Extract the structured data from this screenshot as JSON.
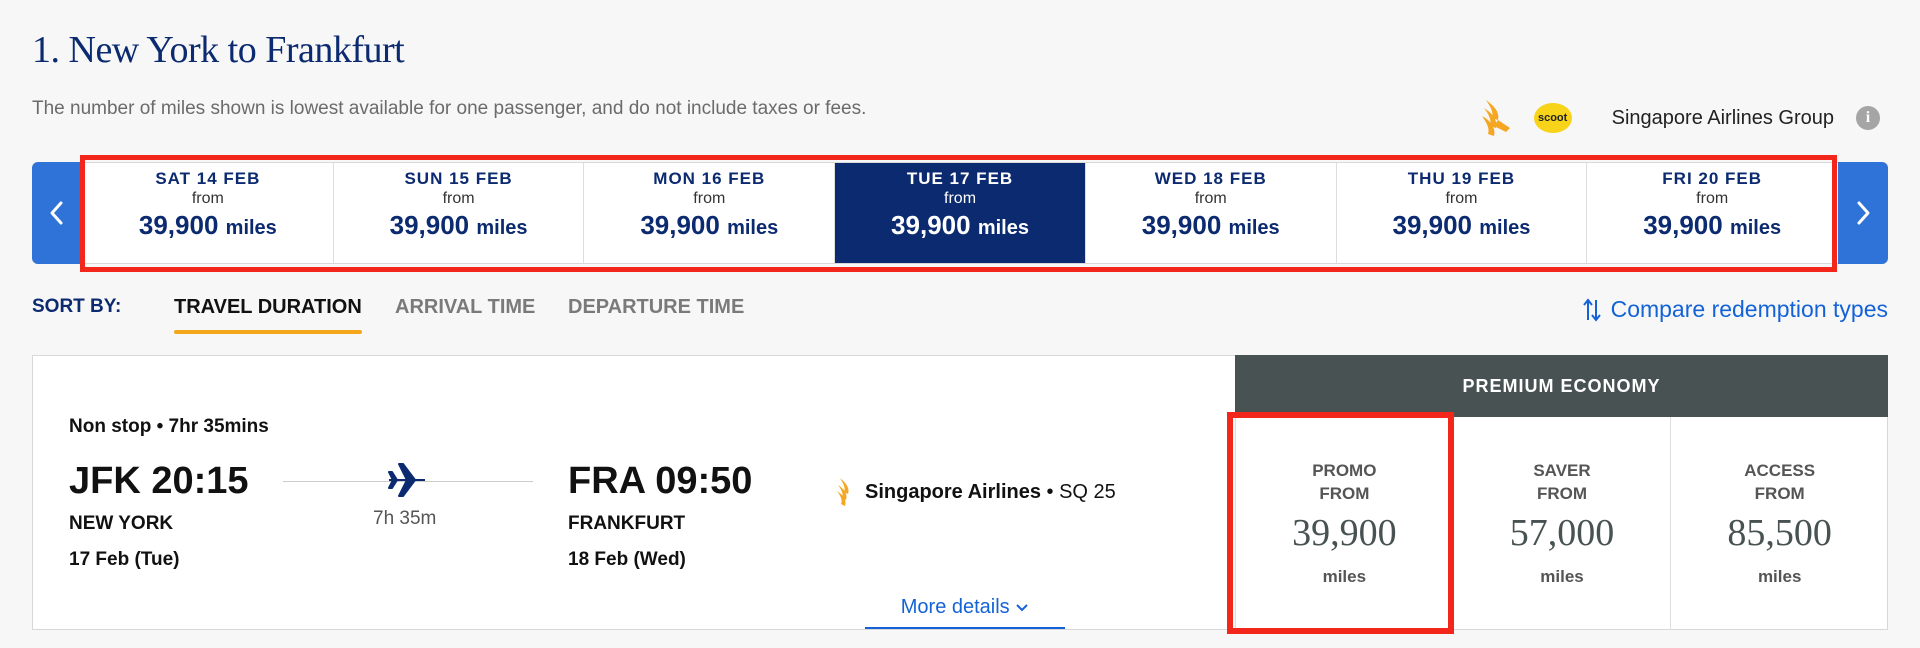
{
  "header": {
    "title": "1. New York to Frankfurt",
    "subtitle": "The number of miles shown is lowest available for one passenger, and do not include taxes or fees.",
    "scoot_logo_text": "scoot",
    "group_label": "Singapore Airlines Group",
    "info_icon": "i"
  },
  "dates": [
    {
      "day": "SAT 14 FEB",
      "from": "from",
      "miles": "39,900",
      "unit": "miles"
    },
    {
      "day": "SUN 15 FEB",
      "from": "from",
      "miles": "39,900",
      "unit": "miles"
    },
    {
      "day": "MON 16 FEB",
      "from": "from",
      "miles": "39,900",
      "unit": "miles"
    },
    {
      "day": "TUE 17 FEB",
      "from": "from",
      "miles": "39,900",
      "unit": "miles"
    },
    {
      "day": "WED 18 FEB",
      "from": "from",
      "miles": "39,900",
      "unit": "miles"
    },
    {
      "day": "THU 19 FEB",
      "from": "from",
      "miles": "39,900",
      "unit": "miles"
    },
    {
      "day": "FRI 20 FEB",
      "from": "from",
      "miles": "39,900",
      "unit": "miles"
    }
  ],
  "selected_date_index": 3,
  "sort": {
    "label": "SORT BY:",
    "tabs": [
      "TRAVEL DURATION",
      "ARRIVAL TIME",
      "DEPARTURE TIME"
    ],
    "active_tab": 0,
    "compare_label": "Compare redemption types"
  },
  "flight": {
    "stops": "Non stop • 7hr 35mins",
    "departure": {
      "time": "JFK 20:15",
      "city": "NEW YORK",
      "date": "17 Feb (Tue)"
    },
    "arrival": {
      "time": "FRA 09:50",
      "city": "FRANKFURT",
      "date": "18 Feb (Wed)"
    },
    "duration": "7h 35m",
    "airline": "Singapore Airlines",
    "flight_no": "• SQ 25",
    "more_details": "More details"
  },
  "cabin": {
    "name": "PREMIUM ECONOMY",
    "fares": [
      {
        "type": "PROMO",
        "from": "FROM",
        "miles": "39,900",
        "unit": "miles"
      },
      {
        "type": "SAVER",
        "from": "FROM",
        "miles": "57,000",
        "unit": "miles"
      },
      {
        "type": "ACCESS",
        "from": "FROM",
        "miles": "85,500",
        "unit": "miles"
      }
    ]
  },
  "colors": {
    "brand_navy": "#0b2a6f",
    "nav_blue": "#2f73d8",
    "link_blue": "#1463d6",
    "highlight_red": "#f2261a",
    "tab_underline": "#f4a61c",
    "cabin_header": "#485252"
  }
}
